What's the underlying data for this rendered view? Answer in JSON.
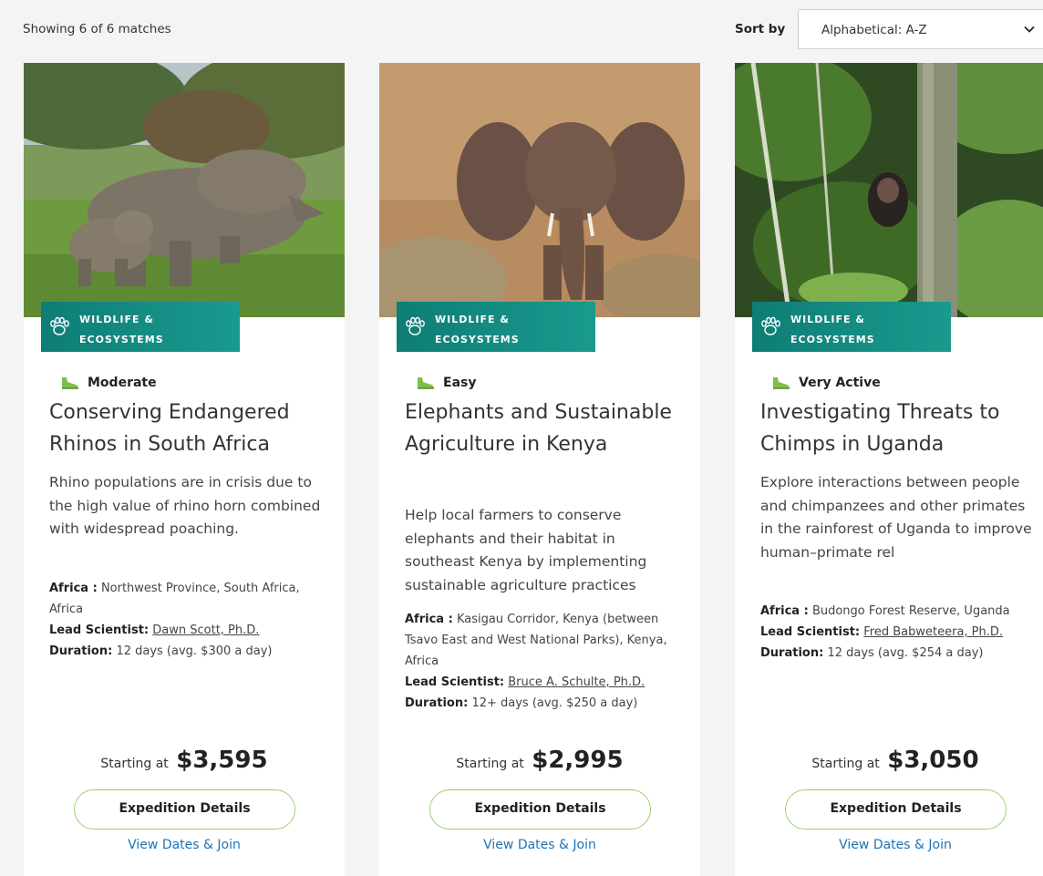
{
  "results": {
    "summary": "Showing 6 of 6 matches"
  },
  "sort": {
    "label": "Sort by",
    "selected": "Alphabetical: A-Z"
  },
  "colors": {
    "accent_teal": "#0e7d76",
    "button_border": "#9ccf6f",
    "link": "#1b74b8"
  },
  "cards": [
    {
      "category": "Wildlife & Ecosystems",
      "category_icon": "paw-icon",
      "activity_icon": "hiking-boot-icon",
      "activity_level": "Moderate",
      "title": "Conserving Endangered Rhinos in South Africa",
      "description": "Rhino populations are in crisis due to the high value of rhino horn combined with widespread poaching.",
      "region_label": "Africa :",
      "location": "Northwest Province, South Africa, Africa",
      "scientist_label": "Lead Scientist:",
      "scientist": "Dawn Scott, Ph.D.",
      "duration_label": "Duration:",
      "duration": "12 days (avg. $300 a day)",
      "price_prefix": "Starting at",
      "price": "$3,595",
      "details_label": "Expedition Details",
      "join_label": "View Dates & Join"
    },
    {
      "category": "Wildlife & Ecosystems",
      "category_icon": "paw-icon",
      "activity_icon": "hiking-boot-icon",
      "activity_level": "Easy",
      "title": "Elephants and Sustainable Agriculture in Kenya",
      "description": "Help local farmers to conserve elephants and their habitat in southeast Kenya by implementing sustainable agriculture practices",
      "region_label": "Africa :",
      "location": "Kasigau Corridor, Kenya (between Tsavo East and West National Parks), Kenya, Africa",
      "scientist_label": "Lead Scientist:",
      "scientist": "Bruce A. Schulte, Ph.D.",
      "duration_label": "Duration:",
      "duration": "12+ days (avg. $250 a day)",
      "price_prefix": "Starting at",
      "price": "$2,995",
      "details_label": "Expedition Details",
      "join_label": "View Dates & Join"
    },
    {
      "category": "Wildlife & Ecosystems",
      "category_icon": "paw-icon",
      "activity_icon": "hiking-boot-icon",
      "activity_level": "Very Active",
      "title": "Investigating Threats to Chimps in Uganda",
      "description": "Explore interactions between people and chimpanzees and other primates in the rainforest of Uganda to improve human–primate rel",
      "region_label": "Africa :",
      "location": "Budongo Forest Reserve, Uganda",
      "scientist_label": "Lead Scientist:",
      "scientist": "Fred Babweteera, Ph.D.",
      "duration_label": "Duration:",
      "duration": "12 days (avg. $254 a day)",
      "price_prefix": "Starting at",
      "price": "$3,050",
      "details_label": "Expedition Details",
      "join_label": "View Dates & Join"
    }
  ]
}
